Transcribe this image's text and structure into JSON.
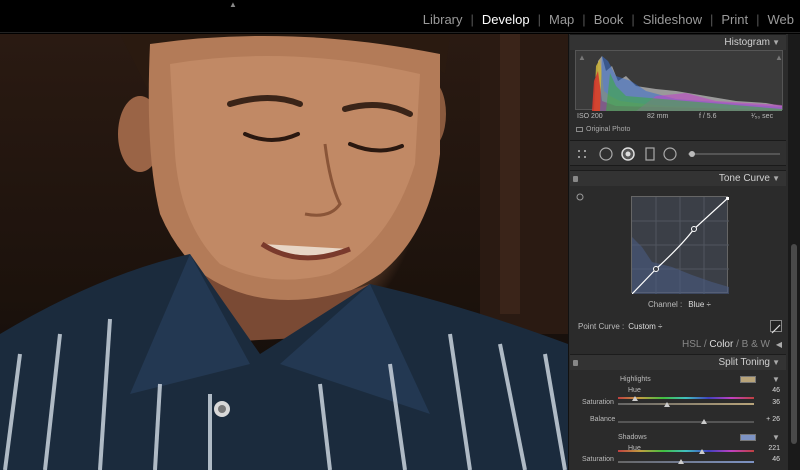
{
  "modules": [
    "Library",
    "Develop",
    "Map",
    "Book",
    "Slideshow",
    "Print",
    "Web"
  ],
  "active_module": "Develop",
  "histogram": {
    "title": "Histogram",
    "iso": "ISO 200",
    "focal": "82 mm",
    "aperture": "f / 5.6",
    "shutter": "¹⁄₅₀ sec",
    "original_photo": "Original Photo"
  },
  "tone_curve": {
    "title": "Tone Curve",
    "channel_label": "Channel :",
    "channel_value": "Blue ÷",
    "point_curve_label": "Point Curve :",
    "point_curve_value": "Custom ÷"
  },
  "hsl": {
    "hsl_label": "HSL",
    "sep1": "/",
    "color_label": "Color",
    "sep2": "/",
    "bw_label": "B & W"
  },
  "split_toning": {
    "title": "Split Toning",
    "highlights": "Highlights",
    "hue_label": "Hue",
    "hue_value": "46",
    "sat_label": "Saturation",
    "sat_value": "36",
    "balance_label": "Balance",
    "balance_value": "+ 26",
    "shadows": "Shadows",
    "sh_hue_label": "Hue",
    "sh_hue_value": "221",
    "sh_sat_label": "Saturation",
    "sh_sat_value": "46",
    "highlight_color": "#b8a47a",
    "shadow_color": "#7d93c4",
    "hue_fraction": 0.128,
    "sat_fraction": 0.36,
    "balance_fraction": 0.63,
    "sh_hue_fraction": 0.614,
    "sh_sat_fraction": 0.46
  },
  "icons": {
    "top_caret": "▲",
    "collapse": "▼",
    "expand": "◀"
  }
}
